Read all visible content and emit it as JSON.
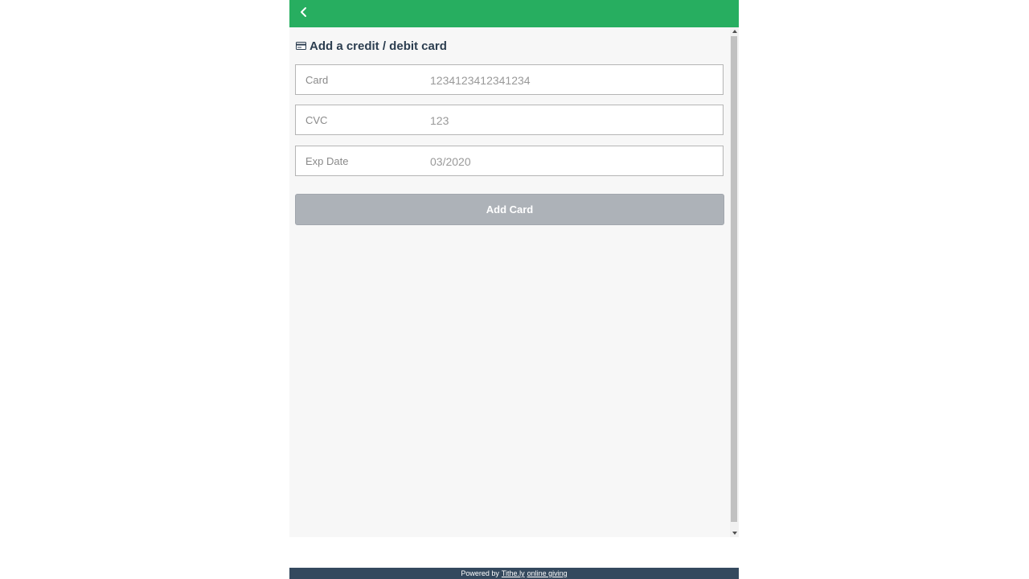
{
  "header": {
    "back_icon": "chevron-left-icon",
    "background_color": "#27ae60"
  },
  "form": {
    "title_icon": "credit-card-icon",
    "title": "Add a credit / debit card",
    "fields": [
      {
        "label": "Card",
        "value": "1234123412341234"
      },
      {
        "label": "CVC",
        "value": "123"
      },
      {
        "label": "Exp Date",
        "value": "03/2020"
      }
    ],
    "submit_label": "Add Card",
    "submit_color": "#adb2b8"
  },
  "footer": {
    "prefix": "Powered by",
    "brand_link": "Tithe.ly",
    "suffix_link": "online giving",
    "background_color": "#34495e"
  }
}
